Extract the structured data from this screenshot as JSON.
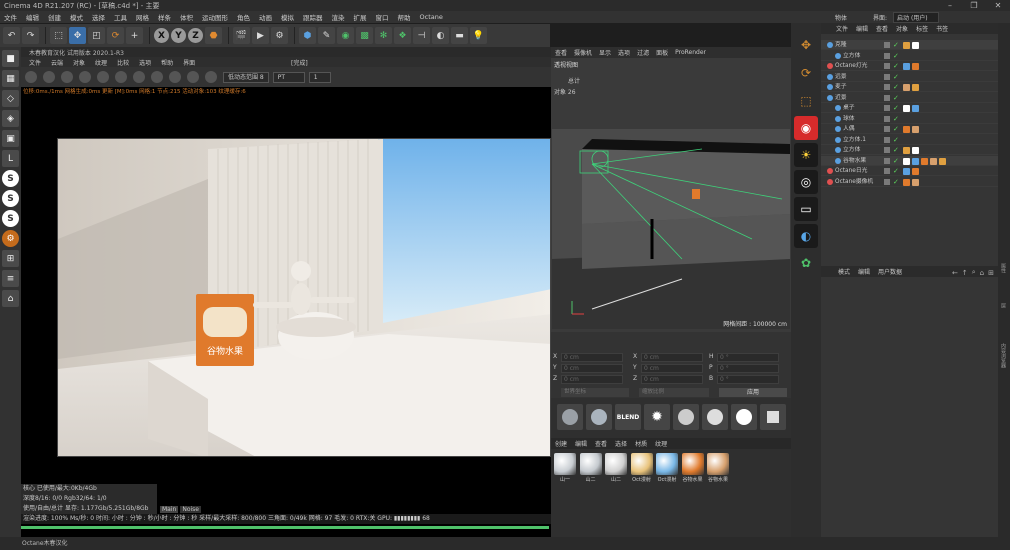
{
  "window": {
    "title": "Cinema 4D R21.207 (RC) - [草稿.c4d *] - 主要"
  },
  "menu": [
    "文件",
    "编辑",
    "创建",
    "模式",
    "选择",
    "工具",
    "网格",
    "样条",
    "体积",
    "运动图形",
    "角色",
    "动画",
    "模拟",
    "跟踪器",
    "渲染",
    "扩展",
    "窗口",
    "帮助",
    "Octane"
  ],
  "topright": {
    "items": [
      "物体",
      "界面:",
      "启动 (用户)"
    ]
  },
  "toolbar": {
    "axes": [
      "X",
      "Y",
      "Z"
    ]
  },
  "left_tools": [
    {
      "icon": "cube-icon",
      "glyph": "■"
    },
    {
      "icon": "checker-icon",
      "glyph": "▦"
    },
    {
      "icon": "cube-outline-icon",
      "glyph": "◇"
    },
    {
      "icon": "cube-edges-icon",
      "glyph": "◈"
    },
    {
      "icon": "cube-faces-icon",
      "glyph": "▣"
    },
    {
      "icon": "corner-icon",
      "glyph": "L"
    },
    {
      "icon": "snap-s-icon",
      "glyph": "S"
    },
    {
      "icon": "snap-s2-icon",
      "glyph": "S"
    },
    {
      "icon": "snap-s3-icon",
      "glyph": "S"
    },
    {
      "icon": "gear-icon",
      "glyph": "⚙"
    },
    {
      "icon": "grid-icon",
      "glyph": "⊞"
    },
    {
      "icon": "layers-icon",
      "glyph": "≡"
    },
    {
      "icon": "lock-icon",
      "glyph": "⌂"
    }
  ],
  "live_viewer": {
    "title": "木春教育汉化  试用版本 2020.1-R3",
    "menu": [
      "文件",
      "云端",
      "对象",
      "纹理",
      "比较",
      "选项",
      "帮助",
      "界面"
    ],
    "status_center": "[完成]",
    "dropdown1": "低动态范围 8",
    "dropdown2": "PT",
    "value": "1",
    "status": "位移:0ms./1ms  网格生成:0ms  更新 [M]:0ms  网格:1  节点:215  活动对象:103  纹理缓存:6",
    "render_text": "谷物水果",
    "stats": [
      "核心  已使用/最大:0Kb/4Gb",
      "深度8/16: 0/0            Rgb32/64: 1/0",
      "使用/自由/总计 显存: 1.177Gb/5.251Gb/8Gb"
    ],
    "tabs": [
      "Main",
      "Noise"
    ],
    "statusbar": "渲染进度: 100%   Ms/秒: 0   时间: 小时 : 分钟 : 秒/小时 : 分钟 : 秒   采样/最大采样: 800/800   三角面: 0/49k  网格: 97   毛发: 0   RTX:关   GPU: ▮▮▮▮▮▮▮▮ 68",
    "progress": 1.0
  },
  "perspective": {
    "menu": [
      "查看",
      "摄像机",
      "显示",
      "选项",
      "过滤",
      "面板",
      "ProRender"
    ],
    "label": "透视视图",
    "info_rows": [
      "总计",
      "对象  26"
    ],
    "footer": "网格间距 : 100000 cm"
  },
  "coords": {
    "labels": [
      "X",
      "Y",
      "Z",
      "X",
      "Y",
      "Z",
      "H",
      "P",
      "B"
    ],
    "values": [
      "0 cm",
      "0 cm",
      "0 cm",
      "0 cm",
      "0 cm",
      "0 cm",
      "0 °",
      "0 °",
      "0 °"
    ],
    "dropdowns": [
      "世界坐标",
      "缩放比例"
    ],
    "apply": "应用"
  },
  "materials": {
    "menu": [
      "创建",
      "编辑",
      "查看",
      "选择",
      "材质",
      "纹理"
    ],
    "items": [
      {
        "label": "山一",
        "color": "#c8cdd2"
      },
      {
        "label": "山二",
        "color": "#c4c9ce"
      },
      {
        "label": "山二",
        "color": "#d0d0d0"
      },
      {
        "label": "Oct漫射",
        "color": "#e8c27a"
      },
      {
        "label": "Oct漫射",
        "color": "#79b7e6"
      },
      {
        "label": "谷物水果",
        "color": "#e07a2c"
      },
      {
        "label": "谷物水果",
        "color": "#d7a06d"
      }
    ]
  },
  "object_manager": {
    "tabs": [
      "文件",
      "编辑",
      "查看",
      "对象",
      "标签",
      "书签"
    ],
    "rows": [
      {
        "name": "克隆",
        "indent": 0
      },
      {
        "name": "立方体",
        "indent": 1
      },
      {
        "name": "Octane灯光",
        "indent": 0
      },
      {
        "name": "远景",
        "indent": 0
      },
      {
        "name": "麦子",
        "indent": 0
      },
      {
        "name": "近景",
        "indent": 0
      },
      {
        "name": "桌子",
        "indent": 1
      },
      {
        "name": "球体",
        "indent": 1
      },
      {
        "name": "人偶",
        "indent": 1
      },
      {
        "name": "立方体.1",
        "indent": 1
      },
      {
        "name": "立方体",
        "indent": 1
      },
      {
        "name": "谷物水果",
        "indent": 1
      },
      {
        "name": "Octane日光",
        "indent": 0
      },
      {
        "name": "Octane摄像机",
        "indent": 0
      }
    ]
  },
  "attributes": {
    "tabs": [
      "模式",
      "编辑",
      "用户数据"
    ]
  },
  "rightrail": [
    "属性",
    "层",
    "内容浏览器"
  ],
  "statusline": "Octane木春汉化",
  "colors": {
    "accent_green": "#4fc26a",
    "accent_orange": "#e07a2c"
  }
}
